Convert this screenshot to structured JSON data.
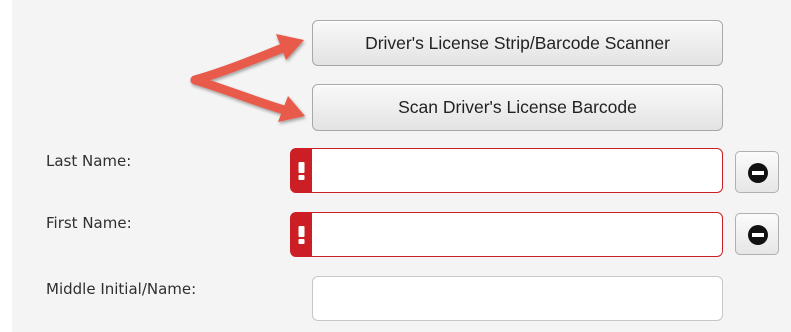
{
  "buttons": {
    "scanner_label": "Driver's License Strip/Barcode Scanner",
    "barcode_label": "Scan Driver's License Barcode"
  },
  "fields": {
    "last_name": {
      "label": "Last Name:",
      "value": ""
    },
    "first_name": {
      "label": "First Name:",
      "value": ""
    },
    "middle_name": {
      "label": "Middle Initial/Name:",
      "value": ""
    }
  },
  "icons": {
    "error_flag": "exclamation-icon",
    "remove": "minus-circle-icon",
    "annotation": "arrow-annotation-icon"
  },
  "colors": {
    "error": "#cc1f25",
    "annotation_arrow": "#e85a4a",
    "panel_background": "#f4f4f4"
  }
}
